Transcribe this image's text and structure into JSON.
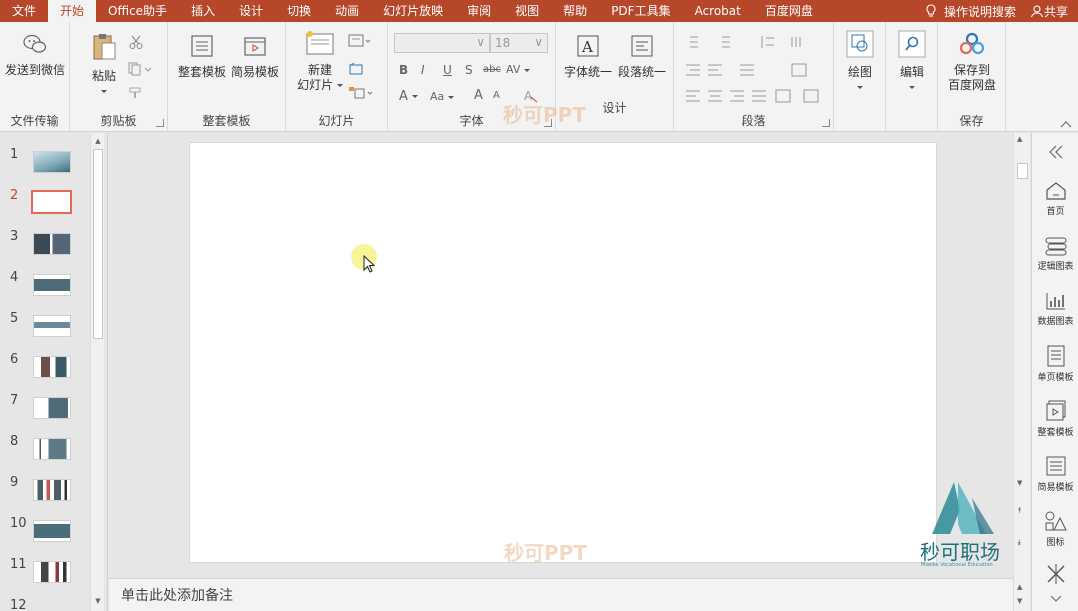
{
  "menu": {
    "tabs": [
      "文件",
      "开始",
      "Office助手",
      "插入",
      "设计",
      "切换",
      "动画",
      "幻灯片放映",
      "审阅",
      "视图",
      "帮助",
      "PDF工具集",
      "Acrobat",
      "百度网盘"
    ],
    "active_tab": "开始",
    "tell_me": "操作说明搜索",
    "share": "共享"
  },
  "ribbon": {
    "file_transfer": {
      "send_wechat": "发送到微信",
      "group_label": "文件传输"
    },
    "clipboard": {
      "paste": "粘贴",
      "group_label": "剪贴板"
    },
    "templates": {
      "full_template": "整套模板",
      "simple_template": "简易模板",
      "group_label": "整套模板"
    },
    "slides": {
      "new_slide_line1": "新建",
      "new_slide_line2": "幻灯片",
      "group_label": "幻灯片"
    },
    "font": {
      "size": "18",
      "group_label": "字体",
      "bold": "B",
      "italic": "I",
      "underline": "U",
      "shadow": "S",
      "strike": "abc",
      "spacing": "AV",
      "font_color": "A",
      "case": "Aa",
      "grow": "A",
      "shrink": "A"
    },
    "design": {
      "font_unify": "字体统一",
      "para_unify": "段落统一",
      "group_label": "设计"
    },
    "paragraph": {
      "group_label": "段落"
    },
    "drawing": {
      "draw": "绘图"
    },
    "editing": {
      "edit": "编辑"
    },
    "save": {
      "save_line1": "保存到",
      "save_line2": "百度网盘",
      "group_label": "保存"
    }
  },
  "slides_panel": {
    "numbers": [
      "1",
      "2",
      "3",
      "4",
      "5",
      "6",
      "7",
      "8",
      "9",
      "10",
      "11",
      "12"
    ],
    "selected": "2"
  },
  "canvas": {
    "watermark_top": "秒可PPT",
    "watermark_bottom": "秒可PPT",
    "notes_placeholder": "单击此处添加备注"
  },
  "side_pane": {
    "items": [
      "首页",
      "逻辑图表",
      "数据图表",
      "单页模板",
      "整套模板",
      "简易模板",
      "图标"
    ]
  },
  "logo": {
    "name": "秒可职场",
    "tagline": "Miaoke Vocational Education"
  },
  "colors": {
    "accent": "#b7472a",
    "selected_thumb": "#e06b55",
    "logo": "#1f6f7a"
  }
}
